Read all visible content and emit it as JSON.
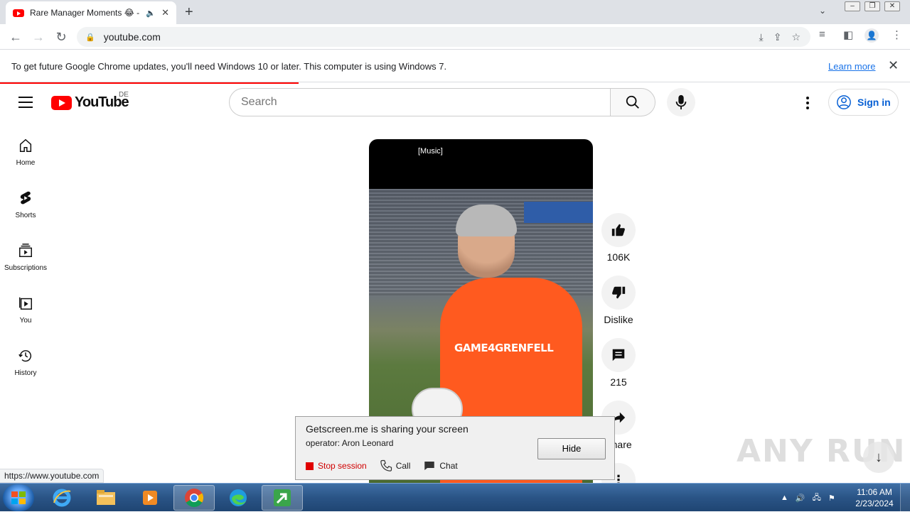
{
  "browser": {
    "tab_title": "Rare Manager Moments 😂 -",
    "url": "youtube.com",
    "infobar_message": "To get future Google Chrome updates, you'll need Windows 10 or later. This computer is using Windows 7.",
    "infobar_link": "Learn more"
  },
  "youtube": {
    "logo_text": "YouTube",
    "country_code": "DE",
    "search_placeholder": "Search",
    "signin_label": "Sign in",
    "sidebar": [
      {
        "label": "Home",
        "icon": "home-icon"
      },
      {
        "label": "Shorts",
        "icon": "shorts-icon"
      },
      {
        "label": "Subscriptions",
        "icon": "subscriptions-icon"
      },
      {
        "label": "You",
        "icon": "you-icon"
      },
      {
        "label": "History",
        "icon": "history-icon"
      }
    ],
    "video": {
      "caption": "[Music]",
      "shirt_text": "GAME4GRENFELL"
    },
    "actions": {
      "likes": "106K",
      "dislike_label": "Dislike",
      "comments": "215",
      "share_label": "Share"
    },
    "status_url": "https://www.youtube.com"
  },
  "getscreen": {
    "title": "Getscreen.me is sharing your screen",
    "operator": "operator: Aron Leonard",
    "hide_label": "Hide",
    "stop_label": "Stop session",
    "call_label": "Call",
    "chat_label": "Chat"
  },
  "watermark": "ANY RUN",
  "taskbar": {
    "time": "11:06 AM",
    "date": "2/23/2024"
  },
  "colors": {
    "youtube_red": "#ff0000",
    "link_blue": "#065fd4",
    "stop_red": "#d00000"
  }
}
